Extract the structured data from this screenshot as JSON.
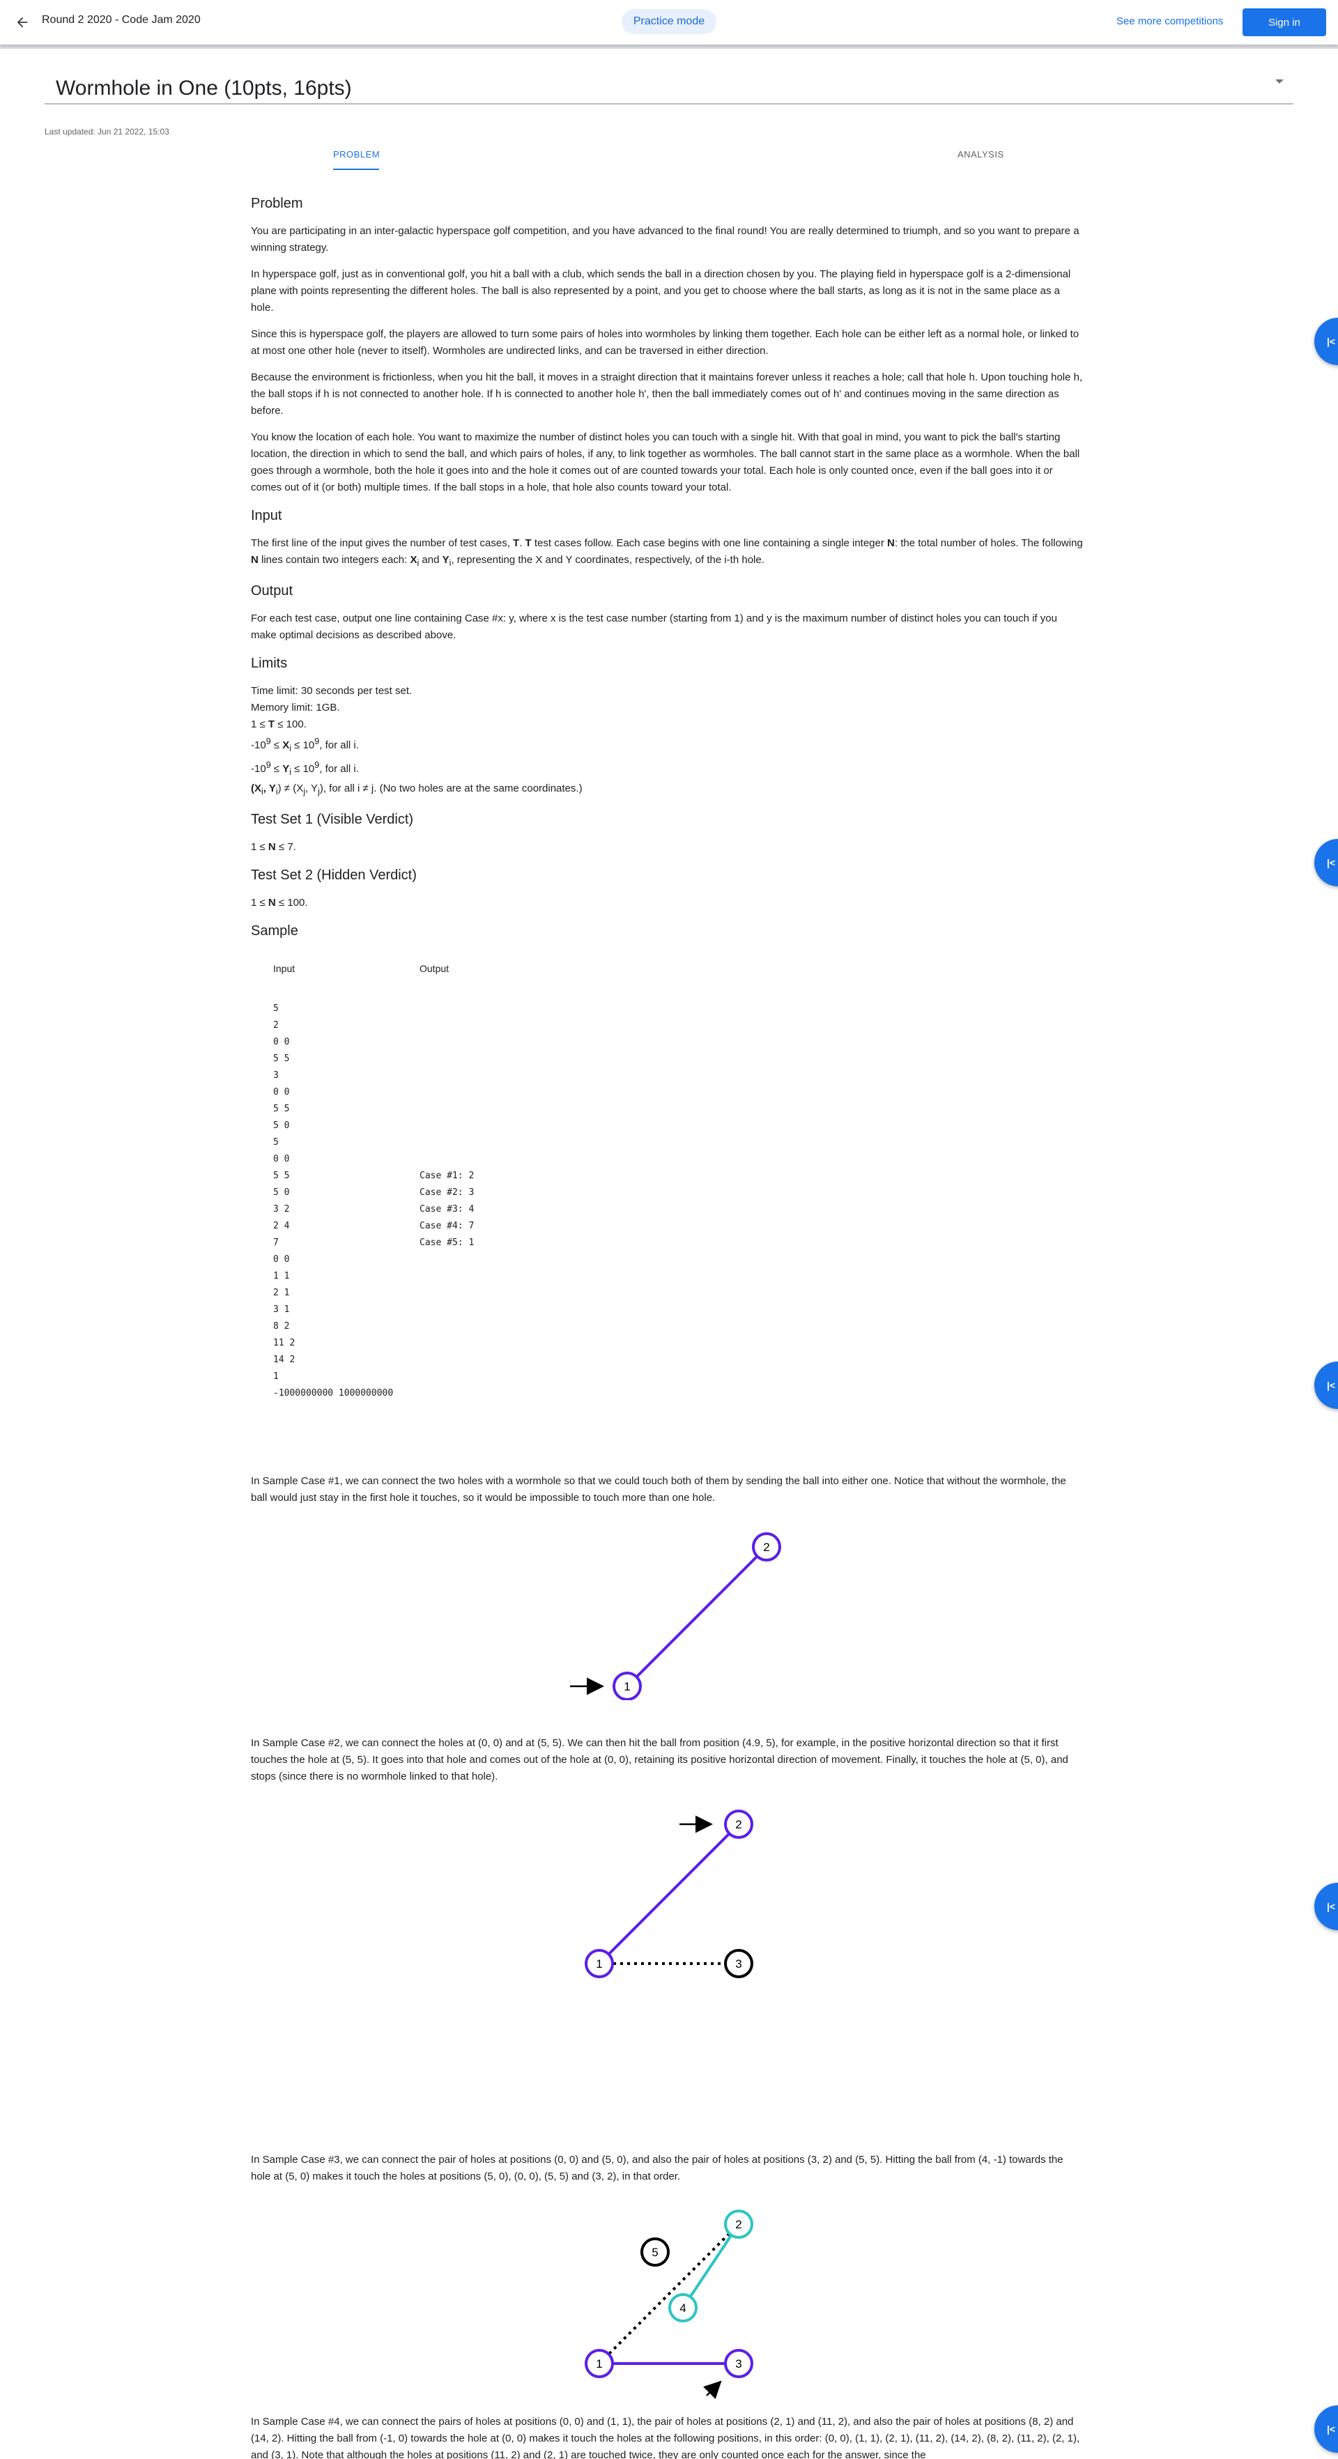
{
  "topbar": {
    "title": "Round 2 2020 - Code Jam 2020",
    "mode": "Practice mode",
    "more_link": "See more competitions",
    "signin": "Sign in"
  },
  "header": {
    "title": "Wormhole in One (10pts, 16pts)",
    "updated": "Last updated: Jun 21 2022, 15:03"
  },
  "tabs": {
    "problem": "PROBLEM",
    "analysis": "ANALYSIS"
  },
  "problem": {
    "heading": "Problem",
    "p1": "You are participating in an inter-galactic hyperspace golf competition, and you have advanced to the final round! You are really determined to triumph, and so you want to prepare a winning strategy.",
    "p2": "In hyperspace golf, just as in conventional golf, you hit a ball with a club, which sends the ball in a direction chosen by you. The playing field in hyperspace golf is a 2-dimensional plane with points representing the different holes. The ball is also represented by a point, and you get to choose where the ball starts, as long as it is not in the same place as a hole.",
    "p3": "Since this is hyperspace golf, the players are allowed to turn some pairs of holes into wormholes by linking them together. Each hole can be either left as a normal hole, or linked to at most one other hole (never to itself). Wormholes are undirected links, and can be traversed in either direction.",
    "p4": "Because the environment is frictionless, when you hit the ball, it moves in a straight direction that it maintains forever unless it reaches a hole; call that hole h. Upon touching hole h, the ball stops if h is not connected to another hole. If h is connected to another hole h', then the ball immediately comes out of h' and continues moving in the same direction as before.",
    "p5": "You know the location of each hole. You want to maximize the number of distinct holes you can touch with a single hit. With that goal in mind, you want to pick the ball's starting location, the direction in which to send the ball, and which pairs of holes, if any, to link together as wormholes. The ball cannot start in the same place as a wormhole. When the ball goes through a wormhole, both the hole it goes into and the hole it comes out of are counted towards your total. Each hole is only counted once, even if the ball goes into it or comes out of it (or both) multiple times. If the ball stops in a hole, that hole also counts toward your total."
  },
  "input": {
    "heading": "Input",
    "t1": "The first line of the input gives the number of test cases, ",
    "T": "T",
    "t2": ". ",
    "t3": " test cases follow. Each case begins with one line containing a single integer ",
    "N": "N",
    "t4": ": the total number of holes. The following ",
    "t5": " lines contain two integers each: ",
    "Xi": "X",
    "i": "i",
    "and": " and ",
    "Yi": "Y",
    "t6": ", representing the X and Y coordinates, respectively, of the i-th hole."
  },
  "output": {
    "heading": "Output",
    "text": "For each test case, output one line containing Case #x: y, where x is the test case number (starting from 1) and y is the maximum number of distinct holes you can touch if you make optimal decisions as described above."
  },
  "limits": {
    "heading": "Limits",
    "l1": "Time limit: 30 seconds per test set.",
    "l2": "Memory limit: 1GB.",
    "l3a": "1 ≤ ",
    "l3b": "T",
    "l3c": " ≤ 100.",
    "l4a": "-10",
    "l4sup": "9",
    "l4b": " ≤ ",
    "l4c": "X",
    "l4d": "i",
    "l4e": " ≤ 10",
    "l4f": "9",
    "l4g": ", for all i.",
    "l5a": "-10",
    "l5sup": "9",
    "l5b": " ≤ ",
    "l5c": "Y",
    "l5d": "i",
    "l5e": " ≤ 10",
    "l5f": "9",
    "l5g": ", for all i.",
    "l6a": "(X",
    "l6b": "i",
    "l6c": ", Y",
    "l6d": "i",
    "l6e": ") ≠ (X",
    "l6f": "j",
    "l6g": ", Y",
    "l6h": "j",
    "l6i": "), for all i ≠ j. (No two holes are at the same coordinates.)"
  },
  "set1": {
    "heading": "Test Set 1 (Visible Verdict)",
    "a": "1 ≤ ",
    "b": "N",
    "c": " ≤ 7."
  },
  "set2": {
    "heading": "Test Set 2 (Hidden Verdict)",
    "a": "1 ≤ ",
    "b": "N",
    "c": " ≤ 100."
  },
  "sample": {
    "heading": "Sample",
    "input_label": "Input",
    "output_label": "Output",
    "input": "5\n2\n0 0\n5 5\n3\n0 0\n5 5\n5 0\n5\n0 0\n5 5\n5 0\n3 2\n2 4\n7\n0 0\n1 1\n2 1\n3 1\n8 2\n11 2\n14 2\n1\n-1000000000 1000000000",
    "output": "Case #1: 2\nCase #2: 3\nCase #3: 4\nCase #4: 7\nCase #5: 1"
  },
  "explanations": {
    "case1": "In Sample Case #1, we can connect the two holes with a wormhole so that we could touch both of them by sending the ball into either one. Notice that without the wormhole, the ball would just stay in the first hole it touches, so it would be impossible to touch more than one hole.",
    "case2": "In Sample Case #2, we can connect the holes at (0, 0) and at (5, 5). We can then hit the ball from position (4.9, 5), for example, in the positive horizontal direction so that it first touches the hole at (5, 5). It goes into that hole and comes out of the hole at (0, 0), retaining its positive horizontal direction of movement. Finally, it touches the hole at (5, 0), and stops (since there is no wormhole linked to that hole).",
    "case3": "In Sample Case #3, we can connect the pair of holes at positions (0, 0) and (5, 0), and also the pair of holes at positions (3, 2) and (5, 5). Hitting the ball from (4, -1) towards the hole at (5, 0) makes it touch the holes at positions (5, 0), (0, 0), (5, 5) and (3, 2), in that order.",
    "case4": "In Sample Case #4, we can connect the pairs of holes at positions (0, 0) and (1, 1), the pair of holes at positions (2, 1) and (11, 2), and also the pair of holes at positions (8, 2) and (14, 2). Hitting the ball from (-1, 0) towards the hole at (0, 0) makes it touch the holes at the following positions, in this order: (0, 0), (1, 1), (2, 1), (11, 2), (14, 2), (8, 2), (11, 2), (2, 1), and (3, 1). Note that although the holes at positions (11, 2) and (2, 1) are touched twice, they are only counted once each for the answer, since the"
  },
  "figures": {
    "fig1_labels": [
      "1",
      "2"
    ],
    "fig2_labels": [
      "1",
      "2",
      "3"
    ],
    "fig3_labels": [
      "1",
      "2",
      "3",
      "4",
      "5"
    ]
  },
  "fab_label": "|<",
  "colors": {
    "purple": "#5b1ee8",
    "teal": "#2ec4c4",
    "black": "#000000",
    "blue": "#1a73e8"
  }
}
